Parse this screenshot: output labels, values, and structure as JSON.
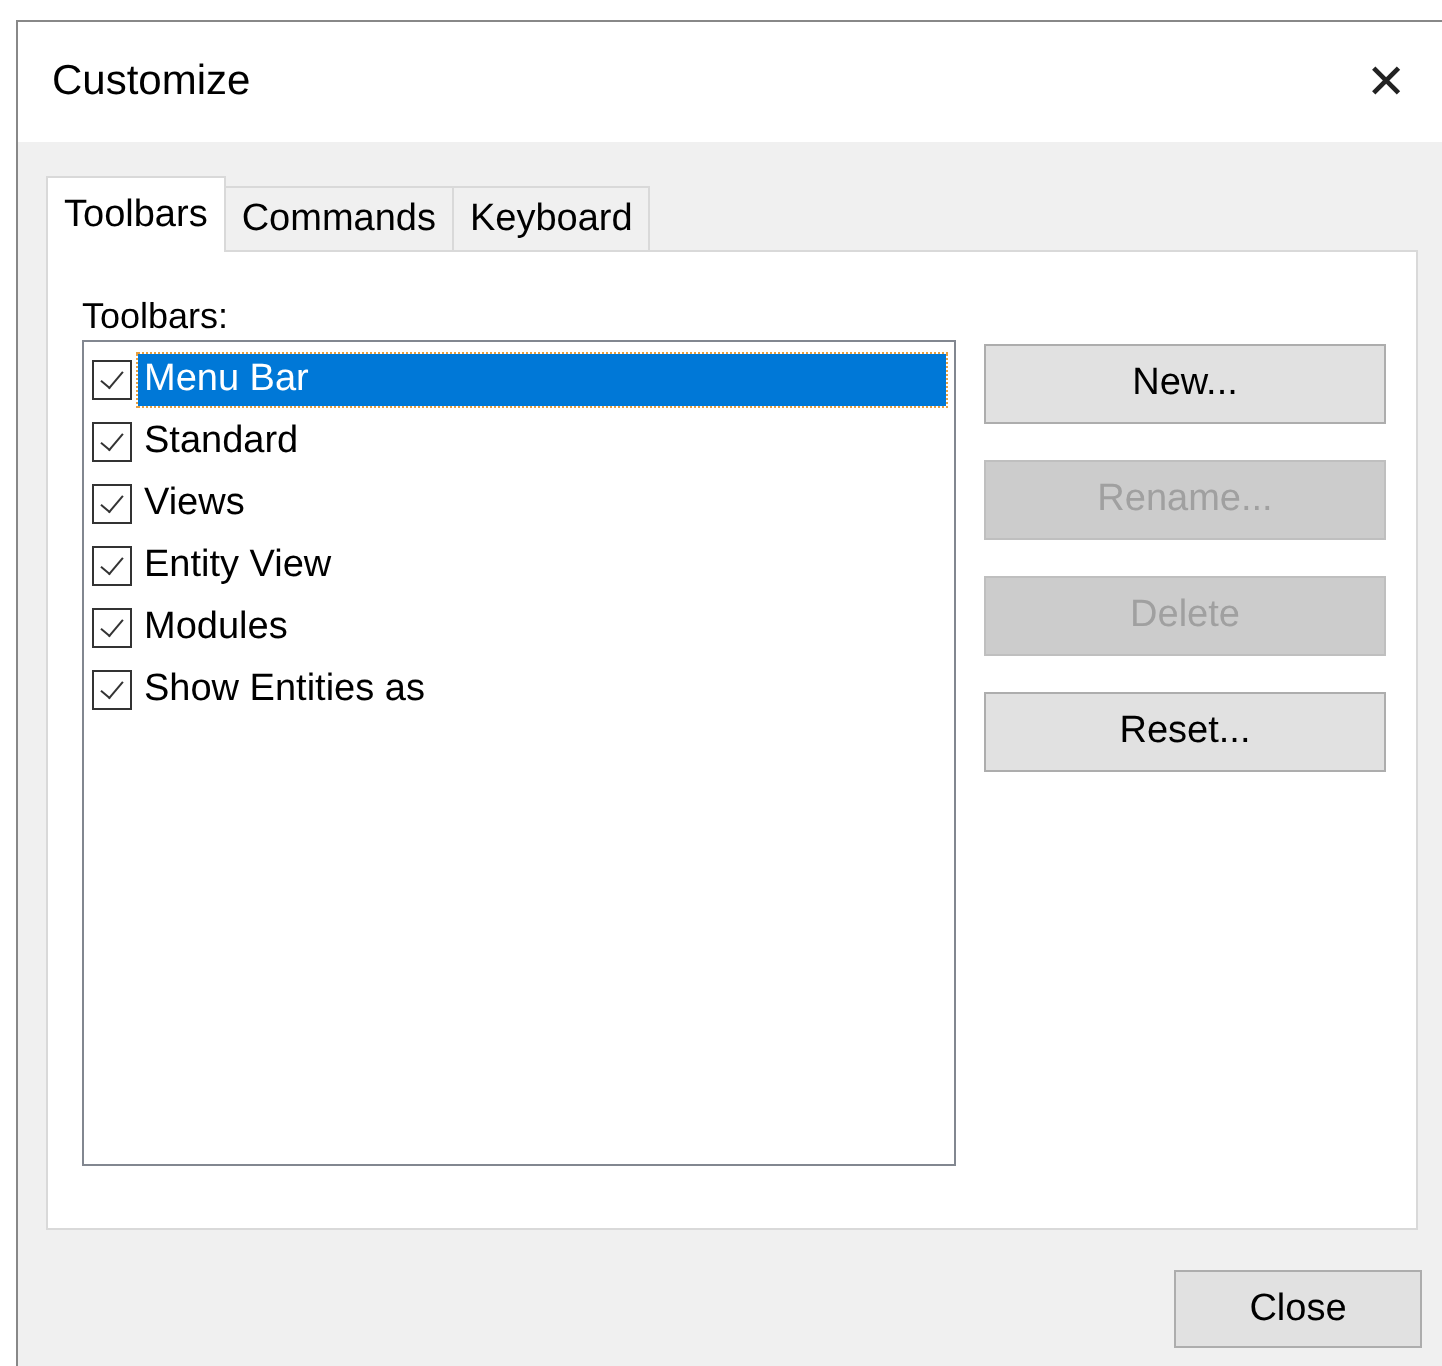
{
  "window": {
    "title": "Customize",
    "close_glyph": "✕"
  },
  "tabs": [
    {
      "label": "Toolbars",
      "selected": true
    },
    {
      "label": "Commands",
      "selected": false
    },
    {
      "label": "Keyboard",
      "selected": false
    }
  ],
  "toolbars": {
    "label": "Toolbars:",
    "items": [
      {
        "label": "Menu Bar",
        "checked": true,
        "selected": true
      },
      {
        "label": "Standard",
        "checked": true,
        "selected": false
      },
      {
        "label": "Views",
        "checked": true,
        "selected": false
      },
      {
        "label": "Entity View",
        "checked": true,
        "selected": false
      },
      {
        "label": "Modules",
        "checked": true,
        "selected": false
      },
      {
        "label": "Show Entities as",
        "checked": true,
        "selected": false
      }
    ]
  },
  "buttons": [
    {
      "label": "New...",
      "disabled": false
    },
    {
      "label": "Rename...",
      "disabled": true
    },
    {
      "label": "Delete",
      "disabled": true
    },
    {
      "label": "Reset...",
      "disabled": false
    }
  ],
  "footer_button": "Close"
}
